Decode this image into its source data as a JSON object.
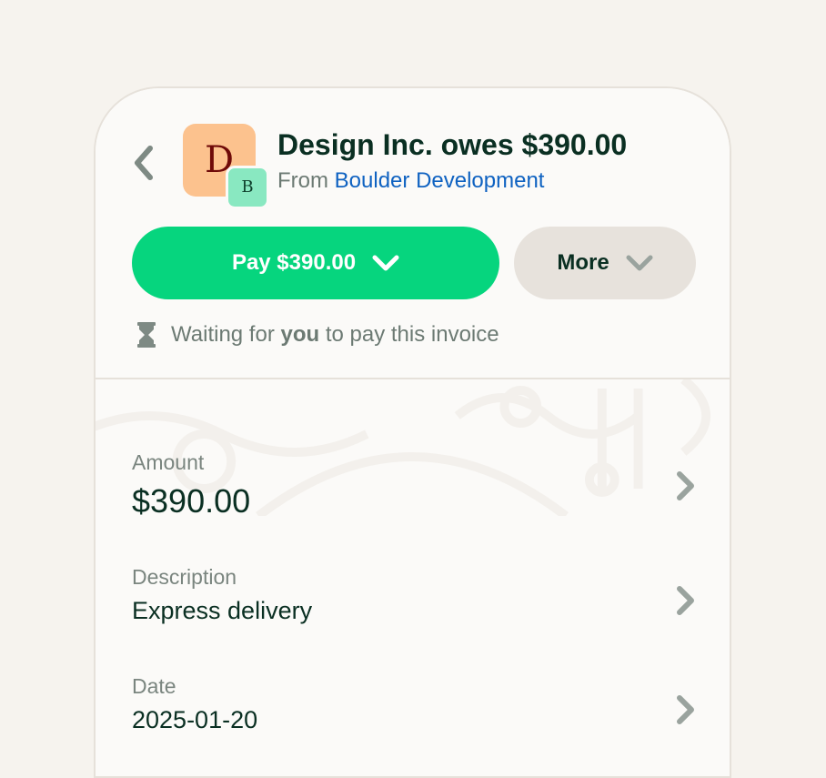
{
  "header": {
    "avatar_letter": "D",
    "avatar_badge_letter": "B",
    "title": "Design Inc. owes $390.00",
    "from_prefix": "From",
    "from_name": "Boulder Development"
  },
  "actions": {
    "pay_label": "Pay $390.00",
    "more_label": "More"
  },
  "status": {
    "text_before": "Waiting for",
    "text_bold": "you",
    "text_after": "to pay this invoice"
  },
  "details": [
    {
      "label": "Amount",
      "value": "$390.00"
    },
    {
      "label": "Description",
      "value": "Express delivery"
    },
    {
      "label": "Date",
      "value": "2025-01-20"
    }
  ],
  "colors": {
    "background": "#f6f3ee",
    "primary": "#06d57e",
    "link": "#0f62c1",
    "text_dark": "#0a2f22",
    "text_muted": "#6c7a73"
  },
  "icons": [
    "back-chevron-icon",
    "chevron-down-icon",
    "hourglass-icon",
    "chevron-right-icon"
  ]
}
